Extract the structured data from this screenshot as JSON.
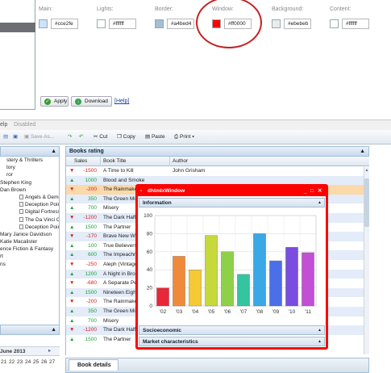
{
  "config": {
    "swatches": [
      {
        "label": "Main:",
        "color": "#cce2fe",
        "value": "#cce2fe"
      },
      {
        "label": "Lights:",
        "color": "#ffffff",
        "value": "#ffffff"
      },
      {
        "label": "Border:",
        "color": "#a4bed4",
        "value": "#a4bed4"
      },
      {
        "label": "Window:",
        "color": "#ff0000",
        "value": "#ff0000"
      },
      {
        "label": "Background:",
        "color": "#ebebeb",
        "value": "#ebebeb"
      },
      {
        "label": "Content:",
        "color": "#ffffff",
        "value": "#ffffff"
      }
    ],
    "apply_label": "Apply",
    "download_label": "Download",
    "help_label": "[Help]"
  },
  "menu": {
    "help": "elp",
    "disabled": "Disabled"
  },
  "toolbar": {
    "save_as": "Save As...",
    "cut": "Cut",
    "copy": "Copy",
    "paste": "Paste",
    "print": "Print"
  },
  "tree_items": [
    "stery & Thrillers",
    "tory",
    "ror",
    "Stephen King",
    "Dan Brown",
    "Angels & Demons",
    "Deception Point",
    "Digital Fortress",
    "The Da Vinci Code",
    "Deception Point",
    "Mary Janice Davidson",
    "Katie Macalister",
    "ence Fiction & Fantasy",
    "rt",
    "ns"
  ],
  "grid": {
    "title": "Books rating",
    "columns": [
      "Sales",
      "Book Title",
      "Author"
    ],
    "rows": [
      {
        "dir": "dn",
        "sales": "-1500",
        "title": "A Time to Kill",
        "author": "John Grisham"
      },
      {
        "dir": "up",
        "sales": "1000",
        "title": "Blood and Smoke",
        "author": ""
      },
      {
        "dir": "dn",
        "sales": "-200",
        "title": "The Rainmaker",
        "author": "",
        "sel": true
      },
      {
        "dir": "up",
        "sales": "350",
        "title": "The Green Mile",
        "author": ""
      },
      {
        "dir": "up",
        "sales": "700",
        "title": "Misery",
        "author": ""
      },
      {
        "dir": "dn",
        "sales": "-1200",
        "title": "The Dark Half",
        "author": ""
      },
      {
        "dir": "up",
        "sales": "1500",
        "title": "The Partner",
        "author": ""
      },
      {
        "dir": "dn",
        "sales": "-170",
        "title": "Brave New World",
        "author": ""
      },
      {
        "dir": "up",
        "sales": "100",
        "title": "True Believers: A",
        "author": ""
      },
      {
        "dir": "up",
        "sales": "600",
        "title": "The Impeachmen",
        "author": ""
      },
      {
        "dir": "dn",
        "sales": "-250",
        "title": "Aleph (Vintage In",
        "author": ""
      },
      {
        "dir": "up",
        "sales": "1200",
        "title": "A Night in Brookl",
        "author": ""
      },
      {
        "dir": "dn",
        "sales": "-680",
        "title": "A Separate Peac",
        "author": ""
      },
      {
        "dir": "up",
        "sales": "1500",
        "title": "Nineteen Eighty-",
        "author": ""
      },
      {
        "dir": "dn",
        "sales": "-200",
        "title": "The Rainmaker",
        "author": ""
      },
      {
        "dir": "up",
        "sales": "350",
        "title": "The Green Mile",
        "author": ""
      },
      {
        "dir": "up",
        "sales": "700",
        "title": "Misery",
        "author": ""
      },
      {
        "dir": "dn",
        "sales": "-1200",
        "title": "The Dark Half",
        "author": ""
      },
      {
        "dir": "up",
        "sales": "1500",
        "title": "The Partner",
        "author": ""
      }
    ]
  },
  "window": {
    "title": "dhtmlxWindow",
    "sections": [
      "Information",
      "Socioeconomic",
      "Market characteristics"
    ]
  },
  "calendar": {
    "month": "June 2013",
    "days": [
      "21",
      "22",
      "23",
      "24",
      "25",
      "26",
      "27"
    ]
  },
  "details": {
    "title": "Book details"
  },
  "chart_data": {
    "type": "bar",
    "categories": [
      "'02",
      "'03",
      "'04",
      "'05",
      "'06",
      "'07",
      "'08",
      "'09",
      "'10",
      "'11"
    ],
    "values": [
      20,
      55,
      40,
      78,
      60,
      35,
      80,
      50,
      65,
      59
    ],
    "ylim": [
      0,
      100
    ],
    "yticks": [
      0,
      20,
      40,
      60,
      80,
      100
    ],
    "colors": [
      "#e8273a",
      "#f08a3a",
      "#f5c936",
      "#c7d93a",
      "#8ed148",
      "#35c4a0",
      "#3aa7e6",
      "#4a6fe8",
      "#7a4ce0",
      "#c24fd6"
    ]
  }
}
